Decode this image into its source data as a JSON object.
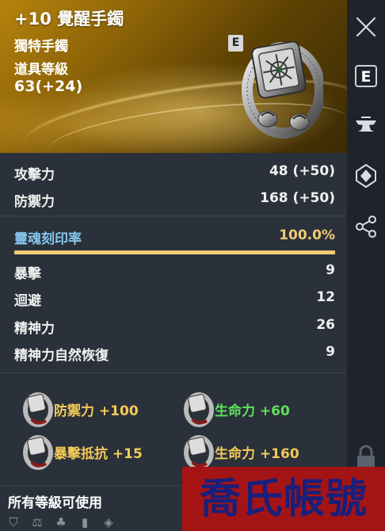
{
  "item": {
    "title": "+10 覺醒手鐲",
    "type": "獨特手鐲",
    "level_label": "道具等級",
    "level_value": "63(+24)",
    "equip_badge": "E"
  },
  "stats": [
    {
      "label": "攻擊力",
      "value": "48 (+50)"
    },
    {
      "label": "防禦力",
      "value": "168 (+50)"
    }
  ],
  "soul": {
    "label": "靈魂刻印率",
    "value": "100.0%",
    "fill": 1.0
  },
  "sub_stats": [
    {
      "label": "暴擊",
      "value": "9"
    },
    {
      "label": "迴避",
      "value": "12"
    },
    {
      "label": "精神力",
      "value": "26"
    },
    {
      "label": "精神力自然恢復",
      "value": "9"
    }
  ],
  "bonuses": [
    {
      "text": "防禦力 +100",
      "color": "#f3cb59"
    },
    {
      "text": "生命力 +60",
      "color": "#5ee25a"
    },
    {
      "text": "暴擊抵抗 +15",
      "color": "#f3cb59"
    },
    {
      "text": "生命力 +160",
      "color": "#f3cb59"
    }
  ],
  "footer": {
    "usable_label": "所有等級可使用"
  },
  "sidebar": {
    "icons": [
      "close-icon",
      "equip-e-icon",
      "anvil-icon",
      "soul-gem-icon",
      "share-icon",
      "lock-icon"
    ],
    "equip_letter": "E"
  },
  "watermark": "喬氏帳號",
  "colors": {
    "gold": "#f3cb59",
    "green": "#5ee25a",
    "soul_label": "#86c8ee",
    "soul_value": "#f1cc74"
  }
}
